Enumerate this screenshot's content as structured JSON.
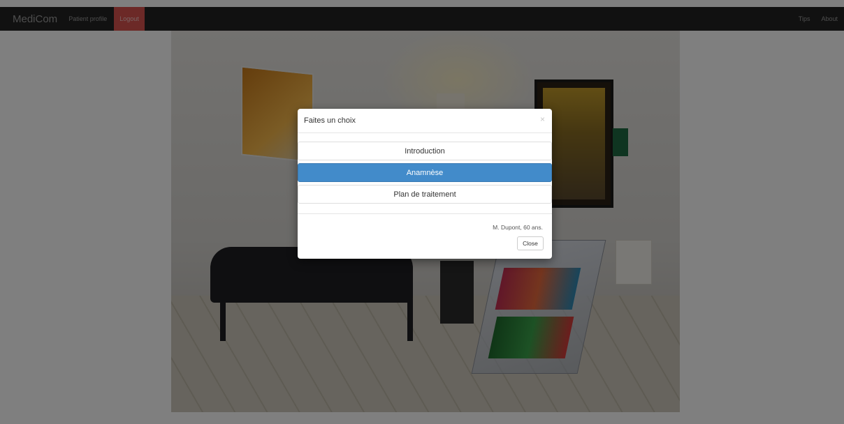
{
  "navbar": {
    "brand": "MediCom",
    "patient_profile": "Patient profile",
    "logout": "Logout",
    "tips": "Tips",
    "about": "About"
  },
  "modal": {
    "title": "Faites un choix",
    "close_icon": "×",
    "options": [
      {
        "label": "Introduction",
        "active": false
      },
      {
        "label": "Anamnèse",
        "active": true
      },
      {
        "label": "Plan de traitement",
        "active": false
      }
    ],
    "patient_info": "M. Dupont, 60 ans.",
    "close_button": "Close"
  },
  "colors": {
    "navbar_bg": "#222222",
    "logout_bg": "#d9534f",
    "active_choice": "#428bca"
  },
  "background_image": "waiting-room-photo"
}
